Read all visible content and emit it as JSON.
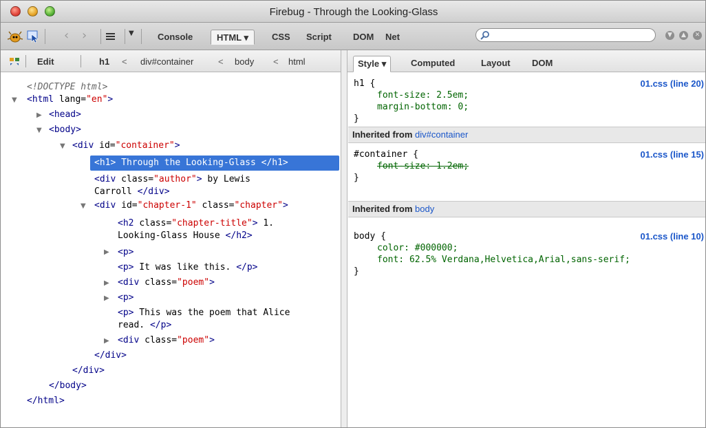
{
  "window": {
    "title": "Firebug - Through the Looking-Glass"
  },
  "toolbar": {
    "tabs": [
      "Console",
      "HTML",
      "CSS",
      "Script",
      "DOM",
      "Net"
    ],
    "html_tab_caret": "▾",
    "search": {
      "value": "",
      "placeholder": ""
    }
  },
  "left_subbar": {
    "edit_label": "Edit",
    "breadcrumbs": [
      "h1",
      "div#container",
      "body",
      "html"
    ],
    "crumb_separator": "<"
  },
  "right_subbar": {
    "tabs": [
      "Style",
      "Computed",
      "Layout",
      "DOM"
    ],
    "style_caret": "▾"
  },
  "html_tree": {
    "doctype": "<!DOCTYPE html>",
    "html_open": {
      "tag": "<html ",
      "attr": "lang=",
      "val": "\"en\"",
      "close": ">"
    },
    "head": "<head>",
    "body_open": "<body>",
    "container_open": {
      "tag": "<div ",
      "attr": "id=",
      "val": "\"container\"",
      "close": ">"
    },
    "h1_line": "<h1> Through the Looking-Glass </h1>",
    "author_open": {
      "tag": "<div ",
      "attr": "class=",
      "val": "\"author\"",
      "close": ">",
      "text": " by Lewis"
    },
    "author_cont": {
      "text": "Carroll ",
      "close": "</div>"
    },
    "chapter_open": {
      "tag": "<div ",
      "attr1": "id=",
      "val1": "\"chapter-1\"",
      "attr2": " class=",
      "val2": "\"chapter\"",
      "close": ">"
    },
    "h2_open": {
      "tag": "<h2 ",
      "attr": "class=",
      "val": "\"chapter-title\"",
      "close": ">",
      "text": " 1."
    },
    "h2_cont": {
      "text": "Looking-Glass House ",
      "close": "</h2>"
    },
    "p_collapsed_1": "<p>",
    "p_like_this": {
      "open": "<p>",
      "text": " It was like this. ",
      "close": "</p>"
    },
    "poem_1": {
      "tag": "<div ",
      "attr": "class=",
      "val": "\"poem\"",
      "close": ">"
    },
    "p_collapsed_2": "<p>",
    "p_poem_open": {
      "open": "<p>",
      "text": " This was the poem that Alice"
    },
    "p_poem_cont": {
      "text": "read. ",
      "close": "</p>"
    },
    "poem_2": {
      "tag": "<div ",
      "attr": "class=",
      "val": "\"poem\"",
      "close": ">"
    },
    "div_close": "</div>",
    "container_close": "</div>",
    "body_close": "</body>",
    "html_close": "</html>"
  },
  "css_rules": {
    "h1": {
      "selector": "h1 {",
      "props": [
        "font-size: 2.5em;",
        "margin-bottom: 0;"
      ],
      "close": "}",
      "source": "01.css (line 20)"
    },
    "inherit_container": {
      "label": "Inherited from ",
      "link": "div#container"
    },
    "container": {
      "selector": "#container {",
      "struck": "font-size: 1.2em;",
      "close": "}",
      "source": "01.css (line 15)"
    },
    "inherit_body": {
      "label": "Inherited from ",
      "link": "body"
    },
    "body": {
      "selector": "body {",
      "props": [
        "color: #000000;",
        "font: 62.5% Verdana,Helvetica,Arial,sans-serif;"
      ],
      "close": "}",
      "source": "01.css (line 10)"
    }
  },
  "colors": {
    "selection": "#3875d7",
    "link": "#1a56c9",
    "tag": "#000088",
    "attr_value": "#cc0000",
    "css_prop": "#006400"
  }
}
